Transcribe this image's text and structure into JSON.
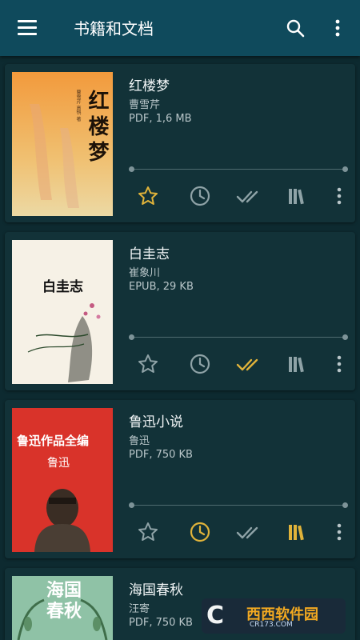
{
  "app_bar": {
    "title": "书籍和文档",
    "menu_icon": "menu-icon",
    "search_icon": "search-icon",
    "more_icon": "more-vert-icon",
    "color": "#0f4a5c"
  },
  "books": [
    {
      "title": "红楼梦",
      "author": "曹雪芹",
      "meta": "PDF, 1,6 MB",
      "cover_text": "红楼梦",
      "cover_small": "曹雪芹 高鹗 著",
      "progress": 0.0,
      "favorite": true,
      "recent": false,
      "read": false,
      "library": false
    },
    {
      "title": "白圭志",
      "author": "崔象川",
      "meta": "EPUB, 29 KB",
      "cover_text": "白圭志",
      "progress": 0.0,
      "favorite": false,
      "recent": false,
      "read": true,
      "library": false
    },
    {
      "title": "鲁迅小说",
      "author": "鲁迅",
      "meta": "PDF, 750 KB",
      "cover_text": "鲁迅作品全编",
      "cover_sub": "鲁迅",
      "progress": 0.0,
      "favorite": false,
      "recent": true,
      "read": false,
      "library": true
    },
    {
      "title": "海国春秋",
      "author": "汪寄",
      "meta": "PDF, 750 KB",
      "cover_text": "海国春秋",
      "progress": 0.0
    }
  ],
  "colors": {
    "active": "#e0b33a",
    "inactive": "#8fa3a7",
    "background": "#0d2a30",
    "card": "#123238"
  },
  "watermark": {
    "logo": "C",
    "text": "西西软件园",
    "url": "CR173.COM"
  }
}
